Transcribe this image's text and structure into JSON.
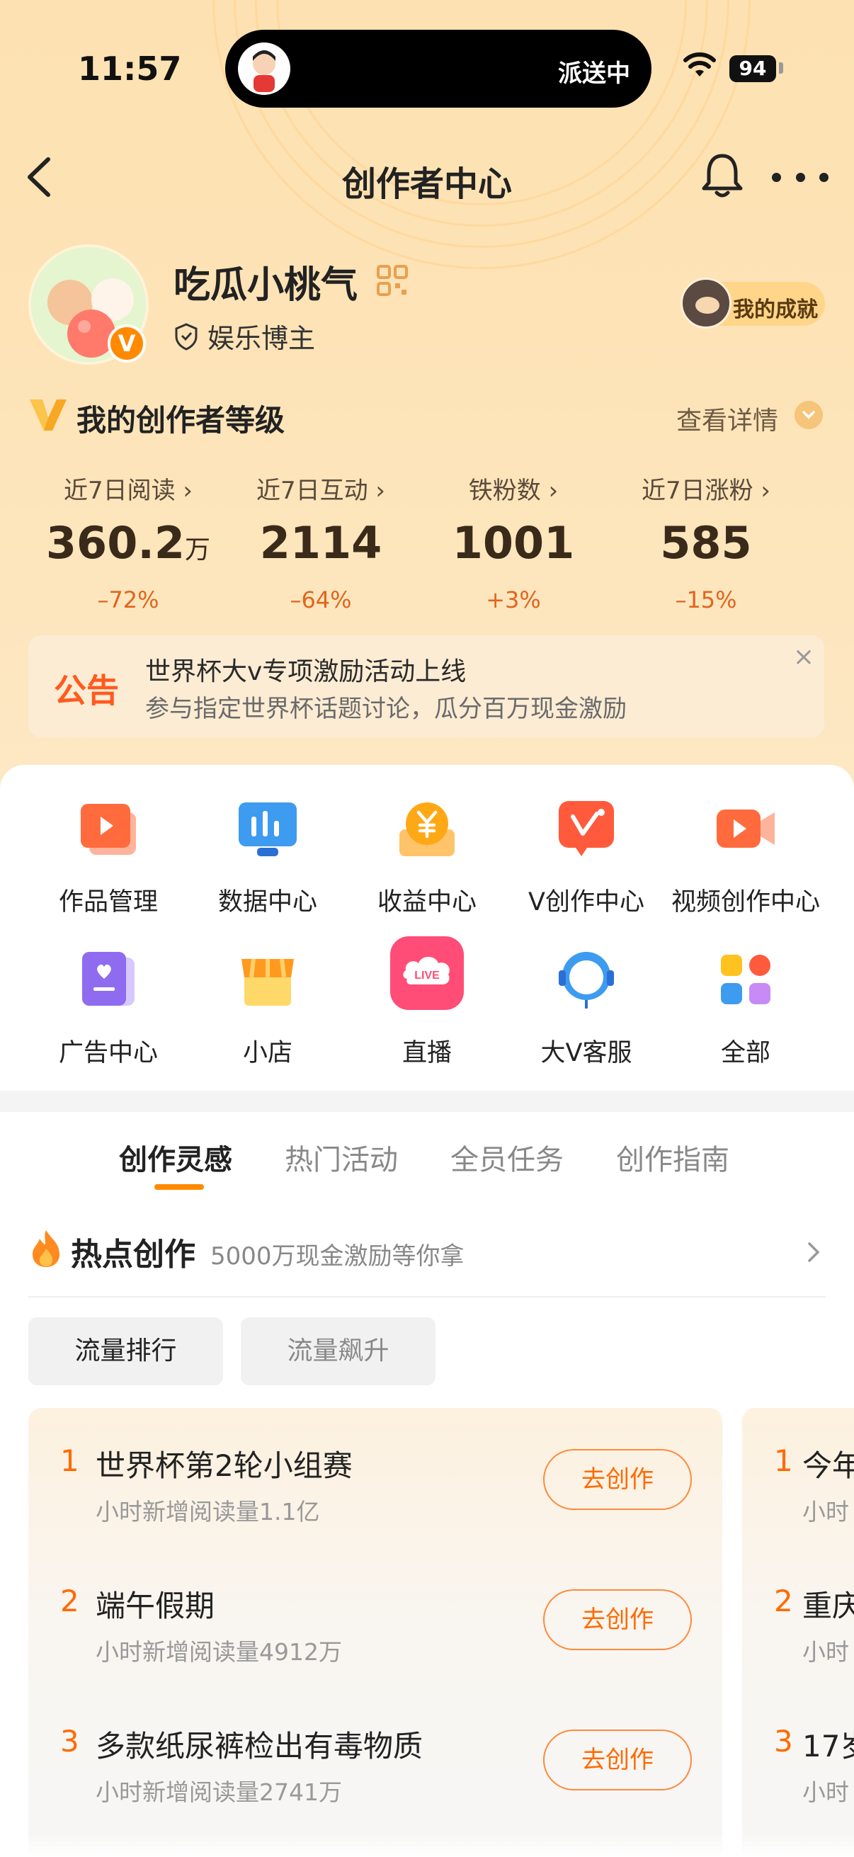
{
  "status_bar": {
    "time": "11:57",
    "island_text": "派送中",
    "battery": "94"
  },
  "nav": {
    "title": "创作者中心"
  },
  "profile": {
    "name": "吃瓜小桃气",
    "role": "娱乐博主",
    "achievement": "我的成就",
    "v_badge": "V"
  },
  "level": {
    "title": "我的创作者等级",
    "detail": "查看详情"
  },
  "stats": [
    {
      "label": "近7日阅读 ›",
      "value": "360.2",
      "unit": "万",
      "change": "–72%"
    },
    {
      "label": "近7日互动 ›",
      "value": "2114",
      "unit": "",
      "change": "–64%"
    },
    {
      "label": "铁粉数 ›",
      "value": "1001",
      "unit": "",
      "change": "+3%"
    },
    {
      "label": "近7日涨粉 ›",
      "value": "585",
      "unit": "",
      "change": "–15%"
    }
  ],
  "notice": {
    "tag": "公告",
    "title": "世界杯大v专项激励活动上线",
    "subtitle": "参与指定世界杯话题讨论，瓜分百万现金激励",
    "close": "×"
  },
  "tools": [
    {
      "label": "作品管理",
      "icon": "works-icon"
    },
    {
      "label": "数据中心",
      "icon": "data-icon"
    },
    {
      "label": "收益中心",
      "icon": "income-icon"
    },
    {
      "label": "V创作中心",
      "icon": "v-create-icon"
    },
    {
      "label": "视频创作中心",
      "icon": "video-create-icon"
    },
    {
      "label": "广告中心",
      "icon": "ad-icon"
    },
    {
      "label": "小店",
      "icon": "shop-icon"
    },
    {
      "label": "直播",
      "icon": "live-icon",
      "icon_text": "LIVE"
    },
    {
      "label": "大V客服",
      "icon": "service-icon"
    },
    {
      "label": "全部",
      "icon": "all-icon"
    }
  ],
  "tabs": [
    "创作灵感",
    "热门活动",
    "全员任务",
    "创作指南"
  ],
  "hot": {
    "title": "热点创作",
    "subtitle": "5000万现金激励等你拿"
  },
  "chips": [
    "流量排行",
    "流量飙升"
  ],
  "ranking": [
    {
      "rank": "1",
      "title": "世界杯第2轮小组赛",
      "sub": "小时新增阅读量1.1亿",
      "button": "去创作"
    },
    {
      "rank": "2",
      "title": "端午假期",
      "sub": "小时新增阅读量4912万",
      "button": "去创作"
    },
    {
      "rank": "3",
      "title": "多款纸尿裤检出有毒物质",
      "sub": "小时新增阅读量2741万",
      "button": "去创作"
    }
  ],
  "ranking2": [
    {
      "rank": "1",
      "title": "今年",
      "sub": "小时"
    },
    {
      "rank": "2",
      "title": "重庆",
      "sub": "小时"
    },
    {
      "rank": "3",
      "title": "17岁",
      "sub": "小时"
    }
  ]
}
